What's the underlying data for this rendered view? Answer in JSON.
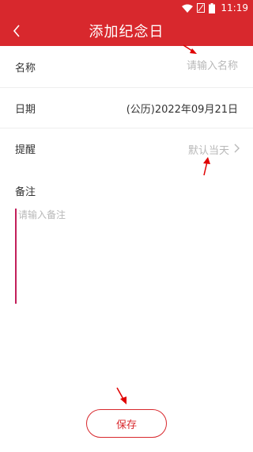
{
  "status_bar": {
    "time": "11:19",
    "icons": [
      "wifi-icon",
      "signal-icon",
      "battery-icon"
    ],
    "color": "#d8282d"
  },
  "header": {
    "title": "添加纪念日",
    "back_icon": "chevron-left-icon"
  },
  "form": {
    "name": {
      "label": "名称",
      "placeholder": "请输入名称"
    },
    "date": {
      "label": "日期",
      "value": "(公历)2022年09月21日"
    },
    "reminder": {
      "label": "提醒",
      "value": "默认当天",
      "icon": "chevron-right-icon"
    },
    "note": {
      "label": "备注",
      "placeholder": "请输入备注"
    }
  },
  "footer": {
    "save_label": "保存"
  },
  "colors": {
    "accent": "#d8282d",
    "placeholder": "#b8b8b8",
    "divider": "#eeeeee"
  }
}
